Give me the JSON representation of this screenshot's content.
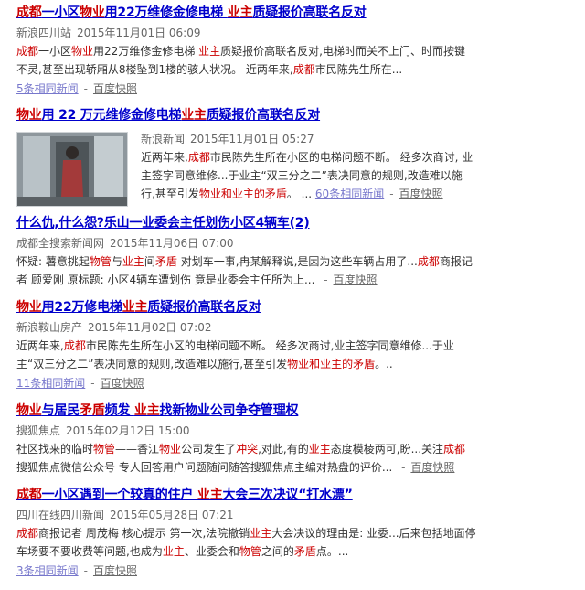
{
  "results": [
    {
      "title": [
        [
          "成都",
          "hl"
        ],
        [
          "一小区",
          ""
        ],
        [
          "物业",
          "hl"
        ],
        [
          "用22万维修金修电梯 ",
          ""
        ],
        [
          "业主",
          "hl"
        ],
        [
          "质疑报价高联名反对",
          ""
        ]
      ],
      "source": "新浪四川站",
      "date": "2015年11月01日 06:09",
      "snippet": [
        [
          [
            "成都",
            "hl"
          ],
          [
            "一小区",
            ""
          ],
          [
            "物业",
            "hl"
          ],
          [
            "用22万维修金修电梯 ",
            ""
          ],
          [
            "业主",
            "hl"
          ],
          [
            "质疑报价高联名反对,电梯时而关不上门、时而按键",
            ""
          ]
        ],
        [
          [
            "不灵,甚至出现轿厢从8楼坠到1楼的骇人状况。 近两年来,",
            ""
          ],
          [
            "成都",
            "hl"
          ],
          [
            "市民陈先生所在...",
            ""
          ]
        ]
      ],
      "related": "5条相同新闻",
      "dash": "-",
      "snapshot": "百度快照"
    },
    {
      "title": [
        [
          "物业",
          "hl"
        ],
        [
          "用 22 万元维修金修电梯",
          ""
        ],
        [
          "业主",
          "hl"
        ],
        [
          "质疑报价高联名反对",
          ""
        ]
      ],
      "source": "新浪新闻",
      "date": "2015年11月01日 05:27",
      "snippet": [
        [
          [
            "近两年来,",
            ""
          ],
          [
            "成都",
            "hl"
          ],
          [
            "市民陈先生所在小区的电梯问题不断。 经多次商讨, 业",
            ""
          ]
        ],
        [
          [
            "主签字同意维修...于业主“双三分之二”表决同意的规则,改造难以施",
            ""
          ]
        ],
        [
          [
            "行,甚至引发",
            ""
          ],
          [
            "物业和业主的矛盾",
            "hl"
          ],
          [
            "。 ... ",
            ""
          ]
        ]
      ],
      "related": "60条相同新闻",
      "dash": "-",
      "snapshot": "百度快照"
    },
    {
      "title": [
        [
          "什么仇,什么怨?乐山一业委会主任划伤小区4辆车(2)",
          ""
        ]
      ],
      "source": "成都全搜索新闻网",
      "date": "2015年11月06日 07:00",
      "snippet": [
        [
          [
            "怀疑: 薯意挑起",
            ""
          ],
          [
            "物管",
            "hl"
          ],
          [
            "与",
            ""
          ],
          [
            "业主",
            "hl"
          ],
          [
            "间",
            ""
          ],
          [
            "矛盾",
            "hl"
          ],
          [
            " 对划车一事,冉某解释说,是因为这些车辆占用了...",
            ""
          ],
          [
            "成都",
            "hl"
          ],
          [
            "商报记",
            ""
          ]
        ],
        [
          [
            "者 顾爱刚 原标题: 小区4辆车遭划伤 竟是业委会主任所为上... ",
            ""
          ]
        ]
      ],
      "related": "",
      "dash": "-",
      "snapshot": "百度快照"
    },
    {
      "title": [
        [
          "物业",
          "hl"
        ],
        [
          "用22万修电梯",
          ""
        ],
        [
          "业主",
          "hl"
        ],
        [
          "质疑报价高联名反对",
          ""
        ]
      ],
      "source": "新浪鞍山房产",
      "date": "2015年11月02日 07:02",
      "snippet": [
        [
          [
            "近两年来,",
            ""
          ],
          [
            "成都",
            "hl"
          ],
          [
            "市民陈先生所在小区的电梯问题不断。 经多次商讨,业主签字同意维修...于业",
            ""
          ]
        ],
        [
          [
            "主“双三分之二”表决同意的规则,改造难以施行,甚至引发",
            ""
          ],
          [
            "物业和业主的矛盾",
            "hl"
          ],
          [
            "。..",
            ""
          ]
        ]
      ],
      "related": "11条相同新闻",
      "dash": "-",
      "snapshot": "百度快照"
    },
    {
      "title": [
        [
          "物业",
          "hl"
        ],
        [
          "与居民",
          ""
        ],
        [
          "矛盾",
          "hl"
        ],
        [
          "频发 ",
          ""
        ],
        [
          "业主",
          "hl"
        ],
        [
          "找新物业公司争夺管理权",
          ""
        ]
      ],
      "source": "搜狐焦点",
      "date": "2015年02月12日 15:00",
      "snippet": [
        [
          [
            "社区找来的临时",
            ""
          ],
          [
            "物管",
            "hl"
          ],
          [
            "——香江",
            ""
          ],
          [
            "物业",
            "hl"
          ],
          [
            "公司发生了",
            ""
          ],
          [
            "冲突",
            "hl"
          ],
          [
            ",对此,有的",
            ""
          ],
          [
            "业主",
            "hl"
          ],
          [
            "态度模棱两可,盼...关注",
            ""
          ],
          [
            "成都",
            "hl"
          ]
        ],
        [
          [
            "搜狐焦点微信公众号 专人回答用户问题随问随答搜狐焦点主编对热盘的评价... ",
            ""
          ]
        ]
      ],
      "related": "",
      "dash": "-",
      "snapshot": "百度快照"
    },
    {
      "title": [
        [
          "成都",
          "hl"
        ],
        [
          "一小区遇到一个较真的住户 ",
          ""
        ],
        [
          "业主",
          "hl"
        ],
        [
          "大会三次决议“打水漂”",
          ""
        ]
      ],
      "source": "四川在线四川新闻",
      "date": "2015年05月28日 07:21",
      "snippet": [
        [
          [
            "成都",
            "hl"
          ],
          [
            "商报记者 周茂梅 核心提示 第一次,法院撤销",
            ""
          ],
          [
            "业主",
            "hl"
          ],
          [
            "大会决议的理由是: 业委...后来包括地面停",
            ""
          ]
        ],
        [
          [
            "车场要不要收费等问题,也成为",
            ""
          ],
          [
            "业主",
            "hl"
          ],
          [
            "、业委会和",
            ""
          ],
          [
            "物管",
            "hl"
          ],
          [
            "之间的",
            ""
          ],
          [
            "矛盾",
            "hl"
          ],
          [
            "点。...",
            ""
          ]
        ]
      ],
      "related": "3条相同新闻",
      "dash": "-",
      "snapshot": "百度快照"
    }
  ]
}
